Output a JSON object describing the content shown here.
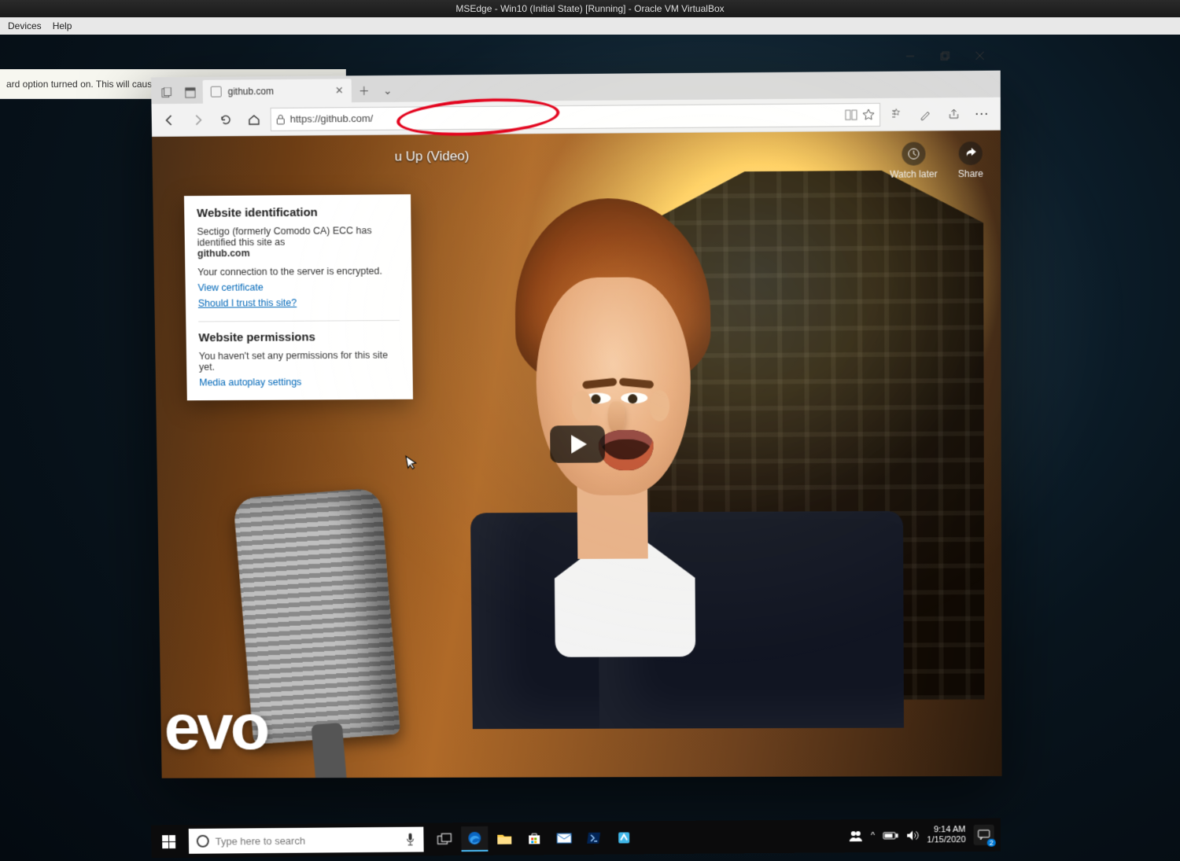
{
  "virtualbox": {
    "title": "MSEdge - Win10 (Initial State) [Running] - Oracle VM VirtualBox",
    "menu": [
      "Devices",
      "Help"
    ],
    "infobar_text": "ard option turned on. This will cause the Virtual Machine to"
  },
  "browser": {
    "tab_title": "github.com",
    "url": "https://github.com/"
  },
  "site_identity": {
    "heading": "Website identification",
    "issuer_line": "Sectigo (formerly Comodo CA) ECC has identified this site as",
    "site": "github.com",
    "encrypted_line": "Your connection to the server is encrypted.",
    "view_cert": "View certificate",
    "trust_link": "Should I trust this site?",
    "perm_heading": "Website permissions",
    "perm_text": "You haven't set any permissions for this site yet.",
    "media_link": "Media autoplay settings"
  },
  "video": {
    "title_fragment": "u Up (Video)",
    "watch_later": "Watch later",
    "share": "Share",
    "logo_text": "evo"
  },
  "taskbar": {
    "search_placeholder": "Type here to search",
    "time": "9:14 AM",
    "date": "1/15/2020",
    "notif_count": "2"
  }
}
